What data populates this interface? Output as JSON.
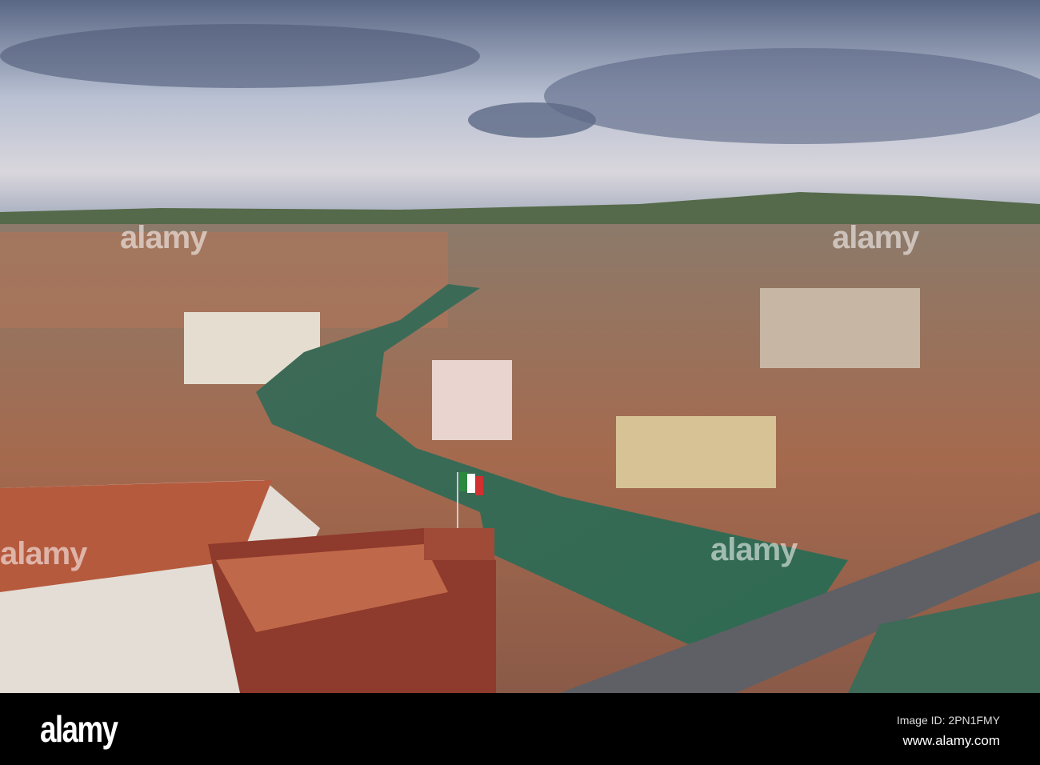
{
  "photo": {
    "subject": "Aerial view of town with canal river, bridge and Italian flag",
    "watermark": "alamy",
    "flag_colors": [
      "#2a8a3e",
      "#ffffff",
      "#d03030"
    ]
  },
  "footer": {
    "logo": "alamy",
    "image_id": "Image ID: 2PN1FMY",
    "website": "www.alamy.com"
  }
}
